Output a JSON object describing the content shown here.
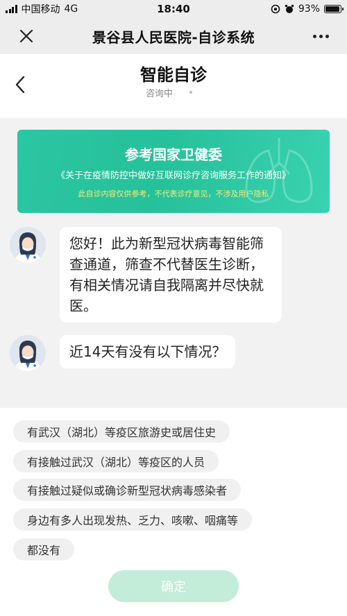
{
  "status_bar": {
    "carrier": "中国移动",
    "network": "4G",
    "time": "18:40",
    "battery": "93%",
    "battery_level": 0.93
  },
  "nav": {
    "title": "景谷县人民医院-自诊系统",
    "close_icon": "close-icon",
    "more_icon": "more-icon"
  },
  "chat_header": {
    "title": "智能自诊",
    "status": "咨询中"
  },
  "banner": {
    "headline": "参考国家卫健委",
    "subtitle": "《关于在疫情防控中做好互联网诊疗咨询服务工作的通知》",
    "note": "此自诊内容仅供参考，不代表诊疗意见，不涉及用户隐私"
  },
  "messages": [
    {
      "text": "您好！此为新型冠状病毒智能筛查通道，筛查不代替医生诊断，有相关情况请自我隔离并尽快就医。"
    },
    {
      "text": "近14天有没有以下情况？"
    }
  ],
  "options": [
    "有武汉（湖北）等疫区旅游史或居住史",
    "有接触过武汉（湖北）等疫区的人员",
    "有接触过疑似或确诊新型冠状病毒感染者",
    "身边有多人出现发热、乏力、咳嗽、咽痛等",
    "都没有"
  ],
  "confirm_label": "确定",
  "colors": {
    "banner": "#25c19a",
    "banner_note": "#f6ea7a",
    "confirm_disabled": "#c3ecd9",
    "option_bg": "#f0f0f0"
  }
}
